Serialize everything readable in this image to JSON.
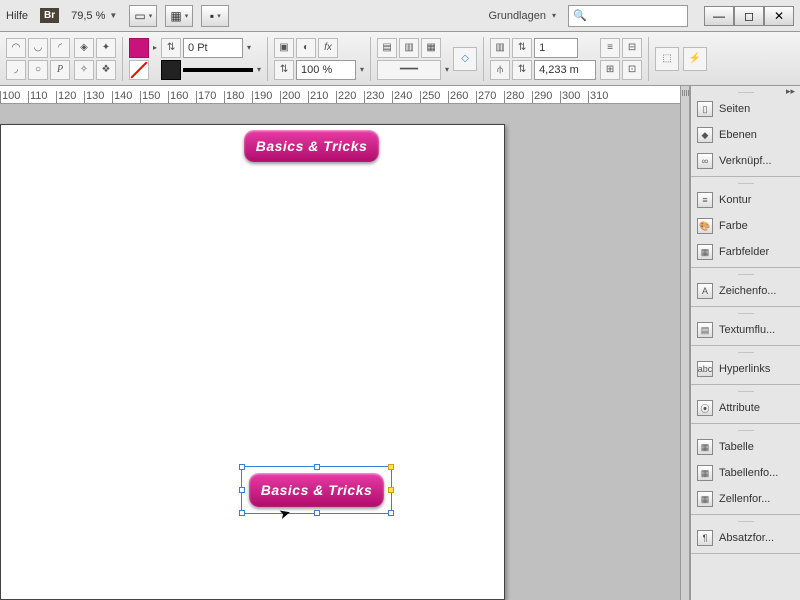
{
  "menubar": {
    "help": "Hilfe",
    "br": "Br",
    "zoom": "79,5 %",
    "workspace_label": "Grundlagen",
    "search_placeholder": ""
  },
  "controls": {
    "stroke_weight": "0 Pt",
    "scale_pct": "100 %",
    "column_count": "1",
    "gutter": "4,233 m"
  },
  "ruler_ticks": [
    "100",
    "110",
    "120",
    "130",
    "140",
    "150",
    "160",
    "170",
    "180",
    "190",
    "200",
    "210",
    "220",
    "230",
    "240",
    "250",
    "260",
    "270",
    "280",
    "290",
    "300",
    "310"
  ],
  "canvas": {
    "button_label": "Basics & Tricks"
  },
  "panels": {
    "g1": [
      "Seiten",
      "Ebenen",
      "Verknüpf..."
    ],
    "g2": [
      "Kontur",
      "Farbe",
      "Farbfelder"
    ],
    "g3": [
      "Zeichenfo..."
    ],
    "g4": [
      "Textumflu..."
    ],
    "g5": [
      "Hyperlinks"
    ],
    "g6": [
      "Attribute"
    ],
    "g7": [
      "Tabelle",
      "Tabellenfo...",
      "Zellenfor..."
    ],
    "g8": [
      "Absatzfor..."
    ]
  },
  "panel_icons": {
    "Seiten": "▯",
    "Ebenen": "◆",
    "Verknüpf...": "∞",
    "Kontur": "≡",
    "Farbe": "🎨",
    "Farbfelder": "▦",
    "Zeichenfo...": "A",
    "Textumflu...": "▤",
    "Hyperlinks": "abc",
    "Attribute": "⦿",
    "Tabelle": "▦",
    "Tabellenfo...": "▦",
    "Zellenfor...": "▦",
    "Absatzfor...": "¶"
  }
}
